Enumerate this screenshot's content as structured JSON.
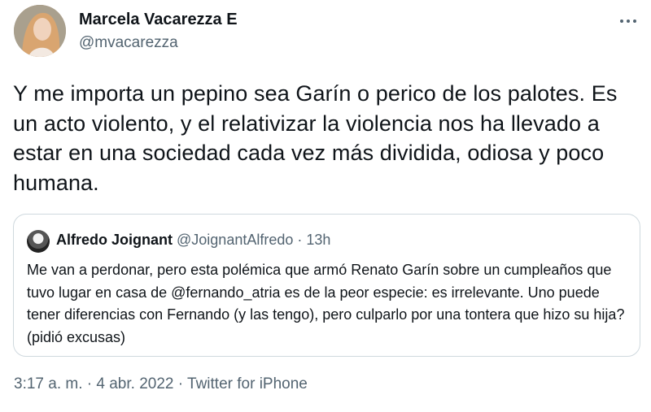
{
  "author": {
    "name": "Marcela Vacarezza E",
    "handle": "@mvacarezza",
    "avatar_icon": "profile-photo"
  },
  "tweet": {
    "text": "Y me importa un pepino sea Garín o perico de los palotes. Es un acto violento, y el relativizar la violencia nos ha llevado a estar en una sociedad cada vez más dividida, odiosa y poco humana."
  },
  "quote": {
    "name": "Alfredo Joignant",
    "handle": "@JoignantAlfredo",
    "separator": "·",
    "time": "13h",
    "text": "Me van a perdonar, pero esta polémica que armó Renato Garín sobre un cumpleaños que tuvo lugar en casa de @fernando_atria es de la peor especie: es irrelevante. Uno puede tener diferencias con Fernando (y las tengo), pero culparlo por una tontera que hizo su hija? (pidió excusas)"
  },
  "meta": {
    "time": "3:17 a. m.",
    "separator1": "·",
    "date": "4 abr. 2022",
    "separator2": "·",
    "source": "Twitter for iPhone"
  },
  "colors": {
    "text": "#0f1419",
    "secondary": "#536471",
    "border": "#cfd9de"
  }
}
